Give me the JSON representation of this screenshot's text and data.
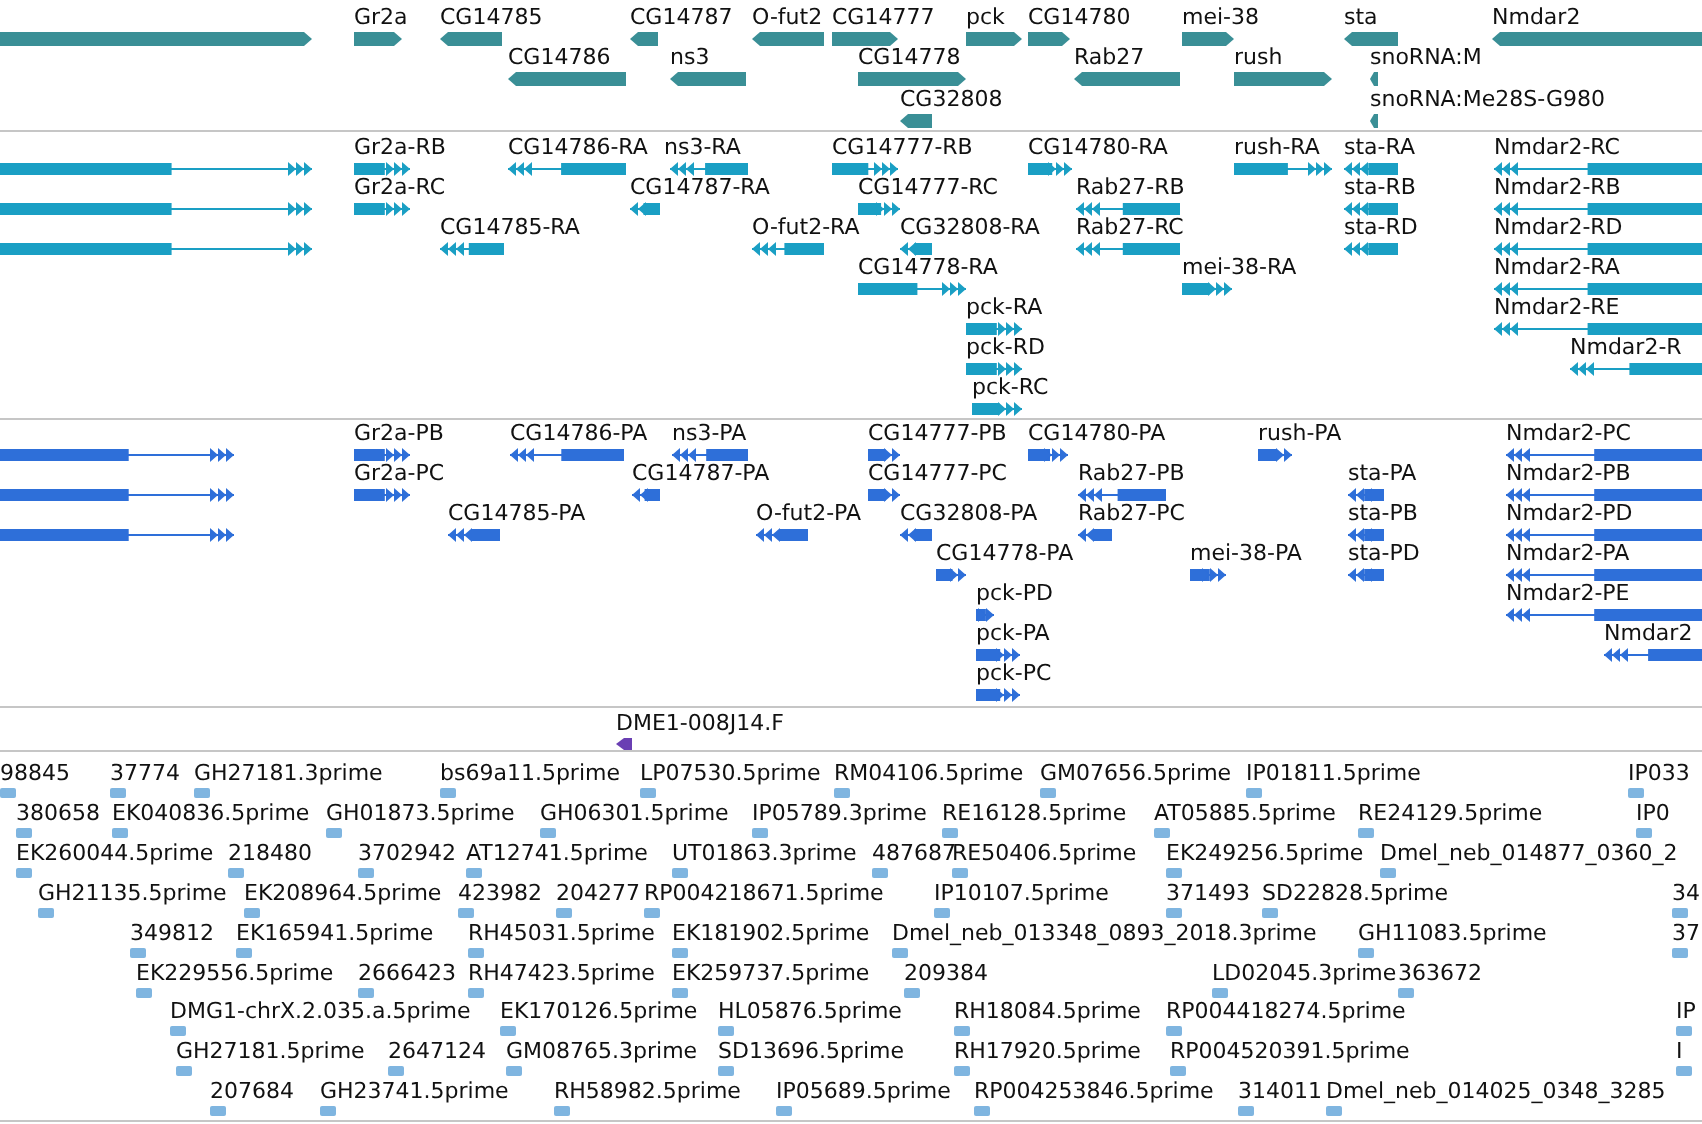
{
  "tracks": [
    {
      "kind": "gene",
      "color": "#3a8f96",
      "features": [
        {
          "reverse": false
        },
        {
          "label": "Gr2a",
          "reverse": false
        },
        {
          "label": "CG14785",
          "reverse": true
        },
        {
          "label": "CG14787",
          "reverse": true
        },
        {
          "label": "O-fut2",
          "reverse": true
        },
        {
          "label": "CG14777",
          "reverse": false
        },
        {
          "label": "pck",
          "reverse": false
        },
        {
          "label": "CG14780",
          "reverse": false
        },
        {
          "label": "mei-38",
          "reverse": false
        },
        {
          "label": "sta",
          "reverse": true
        },
        {
          "label": "Nmdar2",
          "reverse": true
        },
        {
          "label": "CG14786",
          "reverse": true
        },
        {
          "label": "ns3",
          "reverse": true
        },
        {
          "label": "CG14778",
          "reverse": false
        },
        {
          "label": "Rab27",
          "reverse": true
        },
        {
          "label": "rush",
          "reverse": false
        },
        {
          "label": "snoRNA:M",
          "reverse": true
        },
        {
          "label": "CG32808",
          "reverse": true
        },
        {
          "label": "snoRNA:Me28S-G980",
          "reverse": true
        }
      ]
    },
    {
      "kind": "transcript",
      "color": "#1a9fc4",
      "features": [
        {
          "reverse": false
        },
        {
          "label": "Gr2a-RB",
          "reverse": false
        },
        {
          "label": "CG14786-RA",
          "reverse": true
        },
        {
          "label": "ns3-RA",
          "reverse": true
        },
        {
          "label": "CG14777-RB",
          "reverse": false
        },
        {
          "label": "CG14780-RA",
          "reverse": false
        },
        {
          "label": "rush-RA",
          "reverse": false
        },
        {
          "label": "sta-RA",
          "reverse": true
        },
        {
          "label": "Nmdar2-RC",
          "reverse": true
        },
        {
          "reverse": false
        },
        {
          "label": "Gr2a-RC",
          "reverse": false
        },
        {
          "label": "CG14787-RA",
          "reverse": true
        },
        {
          "label": "CG14777-RC",
          "reverse": false
        },
        {
          "label": "Rab27-RB",
          "reverse": true
        },
        {
          "label": "sta-RB",
          "reverse": true
        },
        {
          "label": "Nmdar2-RB",
          "reverse": true
        },
        {
          "reverse": false
        },
        {
          "label": "CG14785-RA",
          "reverse": true
        },
        {
          "label": "O-fut2-RA",
          "reverse": true
        },
        {
          "label": "CG32808-RA",
          "reverse": true
        },
        {
          "label": "Rab27-RC",
          "reverse": true
        },
        {
          "label": "sta-RD",
          "reverse": true
        },
        {
          "label": "Nmdar2-RD",
          "reverse": true
        },
        {
          "label": "CG14778-RA",
          "reverse": false
        },
        {
          "label": "mei-38-RA",
          "reverse": false
        },
        {
          "label": "Nmdar2-RA",
          "reverse": true
        },
        {
          "label": "pck-RA",
          "reverse": false
        },
        {
          "label": "Nmdar2-RE",
          "reverse": true
        },
        {
          "label": "pck-RD",
          "reverse": false
        },
        {
          "label": "Nmdar2-R",
          "reverse": true
        },
        {
          "label": "pck-RC",
          "reverse": false
        }
      ]
    },
    {
      "kind": "protein",
      "color": "#2e6fd9",
      "features": [
        {
          "reverse": false
        },
        {
          "label": "Gr2a-PB",
          "reverse": false
        },
        {
          "label": "CG14786-PA",
          "reverse": true
        },
        {
          "label": "ns3-PA",
          "reverse": true
        },
        {
          "label": "CG14777-PB",
          "reverse": false
        },
        {
          "label": "CG14780-PA",
          "reverse": false
        },
        {
          "label": "rush-PA",
          "reverse": false
        },
        {
          "label": "Nmdar2-PC",
          "reverse": true
        },
        {
          "reverse": false
        },
        {
          "label": "Gr2a-PC",
          "reverse": false
        },
        {
          "label": "CG14787-PA",
          "reverse": true
        },
        {
          "label": "CG14777-PC",
          "reverse": false
        },
        {
          "label": "Rab27-PB",
          "reverse": true
        },
        {
          "label": "sta-PA",
          "reverse": true
        },
        {
          "label": "Nmdar2-PB",
          "reverse": true
        },
        {
          "reverse": false
        },
        {
          "label": "CG14785-PA",
          "reverse": true
        },
        {
          "label": "O-fut2-PA",
          "reverse": true
        },
        {
          "label": "CG32808-PA",
          "reverse": true
        },
        {
          "label": "Rab27-PC",
          "reverse": true
        },
        {
          "label": "sta-PB",
          "reverse": true
        },
        {
          "label": "Nmdar2-PD",
          "reverse": true
        },
        {
          "label": "CG14778-PA",
          "reverse": false
        },
        {
          "label": "mei-38-PA",
          "reverse": false
        },
        {
          "label": "sta-PD",
          "reverse": true
        },
        {
          "label": "Nmdar2-PA",
          "reverse": true
        },
        {
          "label": "pck-PD",
          "reverse": false
        },
        {
          "label": "Nmdar2-PE",
          "reverse": true
        },
        {
          "label": "pck-PA",
          "reverse": false
        },
        {
          "label": "Nmdar2",
          "reverse": true
        },
        {
          "label": "pck-PC",
          "reverse": false
        }
      ]
    },
    {
      "kind": "clone",
      "color": "#6a3fb3",
      "features": [
        {
          "label": "DME1-008J14.F",
          "reverse": true
        }
      ]
    },
    {
      "kind": "est",
      "color": "#7fb5e0",
      "features": [
        {
          "label": "98845"
        },
        {
          "label": "37774"
        },
        {
          "label": "GH27181.3prime"
        },
        {
          "label": "bs69a11.5prime"
        },
        {
          "label": "LP07530.5prime"
        },
        {
          "label": "RM04106.5prime"
        },
        {
          "label": "GM07656.5prime"
        },
        {
          "label": "IP01811.5prime"
        },
        {
          "label": "IP033"
        },
        {
          "label": "380658"
        },
        {
          "label": "EK040836.5prime"
        },
        {
          "label": "GH01873.5prime"
        },
        {
          "label": "GH06301.5prime"
        },
        {
          "label": "IP05789.3prime"
        },
        {
          "label": "RE16128.5prime"
        },
        {
          "label": "AT05885.5prime"
        },
        {
          "label": "RE24129.5prime"
        },
        {
          "label": "IP0"
        },
        {
          "label": "EK260044.5prime"
        },
        {
          "label": "218480"
        },
        {
          "label": "3702942"
        },
        {
          "label": "AT12741.5prime"
        },
        {
          "label": "UT01863.3prime"
        },
        {
          "label": "487687"
        },
        {
          "label": "RE50406.5prime"
        },
        {
          "label": "EK249256.5prime"
        },
        {
          "label": "Dmel_neb_014877_0360_2"
        },
        {
          "label": "GH21135.5prime"
        },
        {
          "label": "EK208964.5prime"
        },
        {
          "label": "423982"
        },
        {
          "label": "204277"
        },
        {
          "label": "RP004218671.5prime"
        },
        {
          "label": "IP10107.5prime"
        },
        {
          "label": "371493"
        },
        {
          "label": "SD22828.5prime"
        },
        {
          "label": "34"
        },
        {
          "label": "349812"
        },
        {
          "label": "EK165941.5prime"
        },
        {
          "label": "RH45031.5prime"
        },
        {
          "label": "EK181902.5prime"
        },
        {
          "label": "Dmel_neb_013348_0893_2018.3prime"
        },
        {
          "label": "GH11083.5prime"
        },
        {
          "label": "37"
        },
        {
          "label": "EK229556.5prime"
        },
        {
          "label": "2666423"
        },
        {
          "label": "RH47423.5prime"
        },
        {
          "label": "EK259737.5prime"
        },
        {
          "label": "209384"
        },
        {
          "label": "LD02045.3prime"
        },
        {
          "label": "363672"
        },
        {
          "label": "DMG1-chrX.2.035.a.5prime"
        },
        {
          "label": "EK170126.5prime"
        },
        {
          "label": "HL05876.5prime"
        },
        {
          "label": "RH18084.5prime"
        },
        {
          "label": "RP004418274.5prime"
        },
        {
          "label": "IP"
        },
        {
          "label": "GH27181.5prime"
        },
        {
          "label": "2647124"
        },
        {
          "label": "GM08765.3prime"
        },
        {
          "label": "SD13696.5prime"
        },
        {
          "label": "RH17920.5prime"
        },
        {
          "label": "RP004520391.5prime"
        },
        {
          "label": "I"
        },
        {
          "label": "207684"
        },
        {
          "label": "GH23741.5prime"
        },
        {
          "label": "RH58982.5prime"
        },
        {
          "label": "IP05689.5prime"
        },
        {
          "label": "RP004253846.5prime"
        },
        {
          "label": "314011"
        },
        {
          "label": "Dmel_neb_014025_0348_3285"
        }
      ]
    }
  ]
}
